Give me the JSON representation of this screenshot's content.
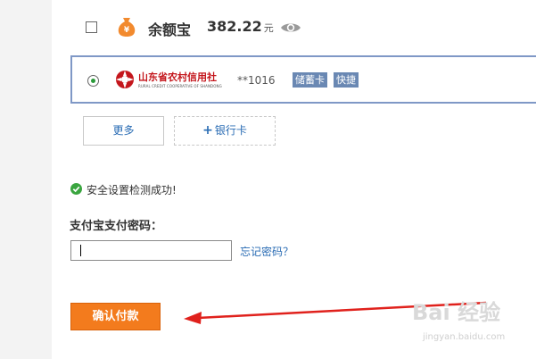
{
  "yuebao": {
    "label": "余额宝",
    "amount": "382.22",
    "unit": "元",
    "checked": false,
    "icon": "money-bag-icon"
  },
  "bank_card": {
    "bank_name": "山东省农村信用社",
    "bank_name_en": "RURAL CREDIT COOPERATIVE OF SHANDONG",
    "card_number": "**1016",
    "badges": [
      "储蓄卡",
      "快捷"
    ],
    "selected": true,
    "border_color": "#7f98c6"
  },
  "buttons": {
    "more_label": "更多",
    "add_card_label": "银行卡",
    "add_card_prefix": "+",
    "confirm_label": "确认付款"
  },
  "security": {
    "message": "安全设置检测成功!"
  },
  "password": {
    "label": "支付宝支付密码：",
    "value": "",
    "forgot_label": "忘记密码？"
  },
  "colors": {
    "accent_orange": "#f37b1d",
    "link_blue": "#2a6cb4",
    "badge_blue": "#6a88b3",
    "annotation_red": "#e0211c",
    "success_green": "#3aa53f"
  },
  "watermark": {
    "main": "Bai 经验",
    "sub": "jingyan.baidu.com"
  }
}
